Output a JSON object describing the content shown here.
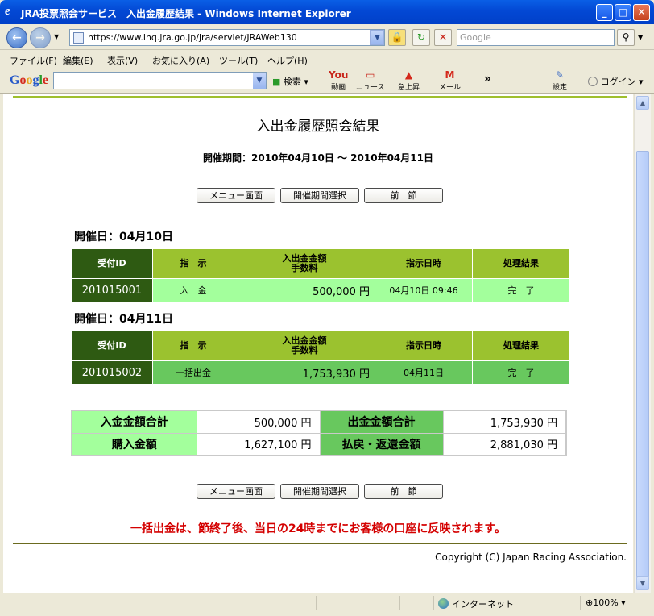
{
  "window": {
    "title": "JRA投票照会サービス　入出金履歴結果 - Windows Internet Explorer"
  },
  "address": {
    "url": "https://www.inq.jra.go.jp/jra/servlet/JRAWeb130",
    "search_placeholder": "Google"
  },
  "menu": [
    "ファイル(F)",
    "編集(E)",
    "表示(V)",
    "お気に入り(A)",
    "ツール(T)",
    "ヘルプ(H)"
  ],
  "google_bar": {
    "logo": "Google",
    "search_label": "検索",
    "tools": [
      {
        "icon": "You",
        "label": "動画"
      },
      {
        "icon": "▭",
        "label": "ニュース"
      },
      {
        "icon": "▲",
        "label": "急上昇"
      },
      {
        "icon": "M",
        "label": "メール"
      }
    ],
    "more": "»",
    "settings": "設定",
    "login": "ログイン"
  },
  "page": {
    "title": "入出金履歴照会結果",
    "period": "開催期間：2010年04月10日 ～ 2010年04月11日",
    "buttons": {
      "menu": "メニュー画面",
      "select": "開催期間選択",
      "prev": "前　節"
    },
    "columns": {
      "id": "受付ID",
      "instruction": "指　示",
      "amount_l1": "入出金金額",
      "amount_l2": "手数料",
      "datetime": "指示日時",
      "result": "処理結果"
    },
    "days": [
      {
        "heading": "開催日：04月10日",
        "row": {
          "id": "201015001",
          "instruction": "入　金",
          "amount": "500,000",
          "yen": "円",
          "datetime": "04月10日 09:46",
          "result": "完　了"
        }
      },
      {
        "heading": "開催日：04月11日",
        "row": {
          "id": "201015002",
          "instruction": "一括出金",
          "amount": "1,753,930",
          "yen": "円",
          "datetime": "04月11日",
          "result": "完　了"
        }
      }
    ],
    "summary": {
      "deposit_label": "入金金額合計",
      "deposit_value": "500,000 円",
      "withdraw_label": "出金金額合計",
      "withdraw_value": "1,753,930 円",
      "purchase_label": "購入金額",
      "purchase_value": "1,627,100 円",
      "refund_label": "払戻・返還金額",
      "refund_value": "2,881,030 円"
    },
    "notice": "一括出金は、節終了後、当日の24時までにお客様の口座に反映されます。",
    "copyright": "Copyright (C) Japan Racing Association."
  },
  "status": {
    "zone": "インターネット",
    "zoom": "100%"
  },
  "colors": {
    "header_green": "#9bc22f",
    "id_dark_green": "#2e5a12",
    "row_light_green": "#a3ff9c",
    "row_mid_green": "#68c85e",
    "notice_red": "#d40000"
  }
}
